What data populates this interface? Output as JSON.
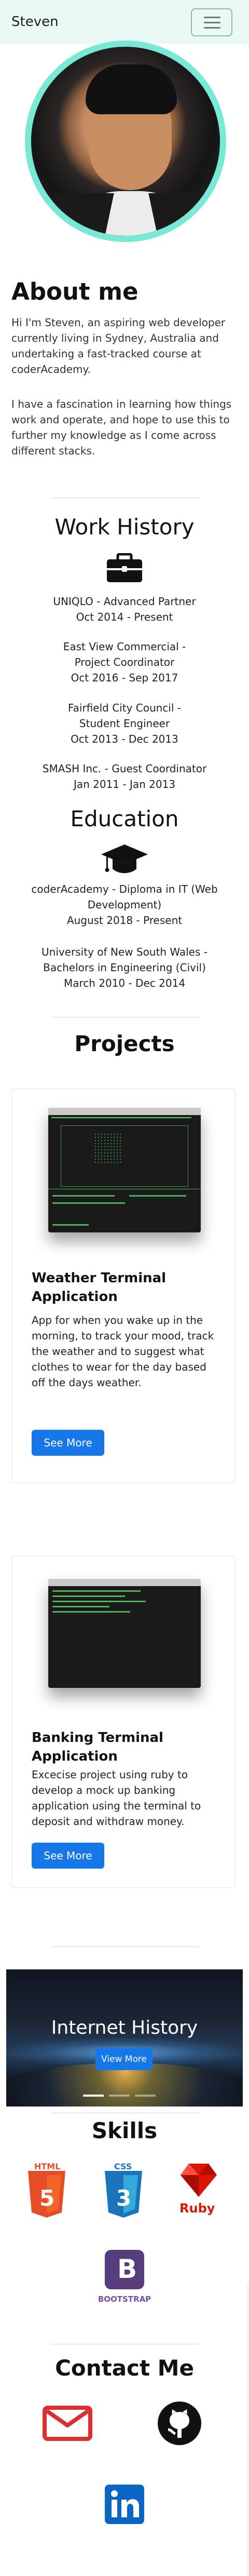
{
  "brand": {
    "name": "Steven"
  },
  "about": {
    "title": "About me",
    "p1": "Hi I'm Steven, an aspiring web developer currently living in Sydney, Australia and undertaking a fast-tracked course at coderAcademy.",
    "p2": "I have a fascination in learning how things work and operate, and hope to use this to further my knowledge as I come across different stacks."
  },
  "work": {
    "title": "Work History",
    "jobs": [
      {
        "title": "UNIQLO - Advanced Partner",
        "dates": "Oct 2014 - Present"
      },
      {
        "title": "East View Commercial - Project Coordinator",
        "dates": "Oct 2016 - Sep 2017"
      },
      {
        "title": "Fairfield City Council - Student Engineer",
        "dates": "Oct 2013 - Dec 2013"
      },
      {
        "title": "SMASH Inc. - Guest Coordinator",
        "dates": "Jan 2011 - Jan 2013"
      }
    ]
  },
  "education": {
    "title": "Education",
    "items": [
      {
        "title": "coderAcademy - Diploma in IT (Web Development)",
        "dates": "August 2018 - Present"
      },
      {
        "title": "University of New South Wales - Bachelors in Engineering (Civil)",
        "dates": "March 2010 - Dec 2014"
      }
    ]
  },
  "projects": {
    "title": "Projects",
    "items": [
      {
        "title": "Weather Terminal Application",
        "text": "App for when you wake up in the morning, to track your mood, track the weather and to suggest what clothes to wear for the day based off the days weather.",
        "button": "See More"
      },
      {
        "title": "Banking Terminal Application",
        "text": "Excecise project using ruby to develop a mock up banking application using the terminal to deposit and withdraw money.",
        "button": "See More"
      }
    ]
  },
  "history": {
    "title": "Internet History",
    "button": "View More"
  },
  "skills": {
    "title": "Skills",
    "items": [
      {
        "name": "HTML",
        "glyph": "5",
        "color": "#e44d26",
        "icon": "html5-icon"
      },
      {
        "name": "CSS",
        "glyph": "3",
        "color": "#1b73ba",
        "icon": "css3-icon"
      },
      {
        "name": "Ruby",
        "glyph": "",
        "color": "#d91505",
        "icon": "ruby-icon"
      },
      {
        "name": "BOOTSTRAP",
        "glyph": "B",
        "color": "#563d7c",
        "icon": "bootstrap-icon"
      }
    ]
  },
  "contact": {
    "title": "Contact Me",
    "items": [
      {
        "icon": "email-icon",
        "color": "#dc2f32"
      },
      {
        "icon": "github-icon",
        "color": "#111111"
      },
      {
        "icon": "linkedin-icon",
        "color": "#0a66c2"
      }
    ]
  }
}
